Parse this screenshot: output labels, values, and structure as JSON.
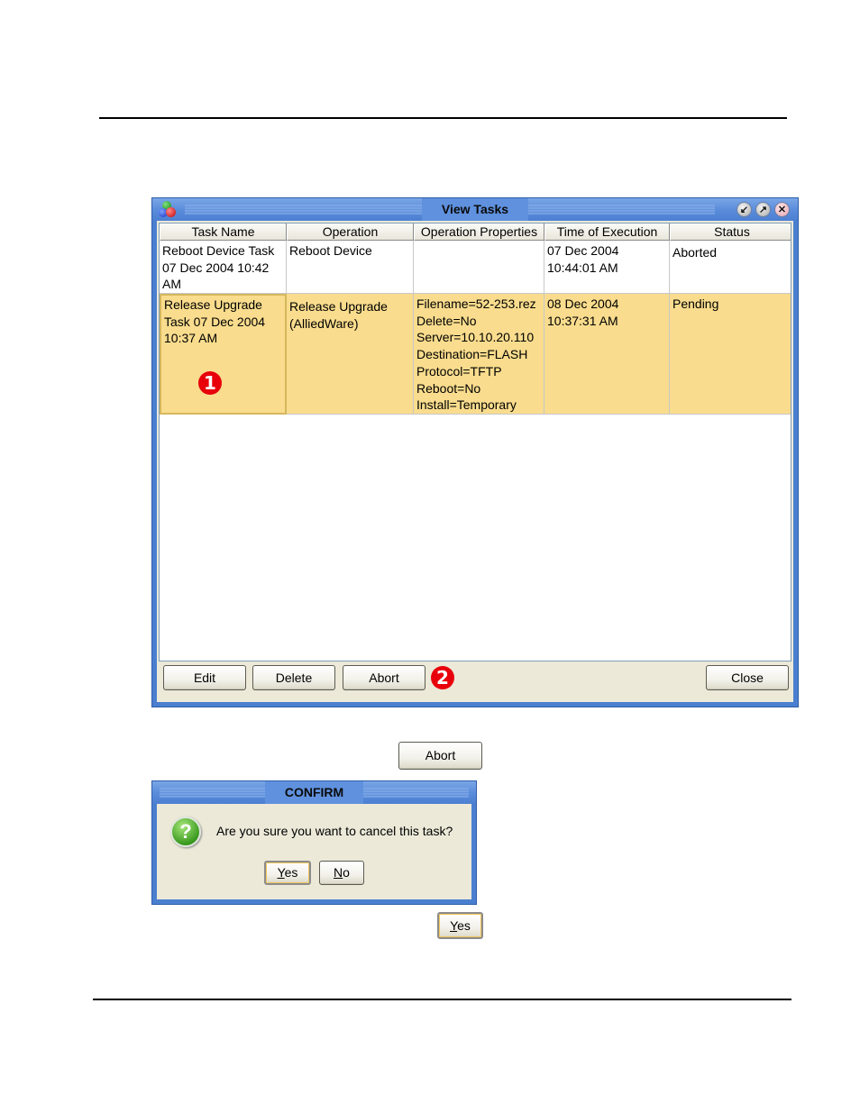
{
  "window": {
    "title": "View Tasks",
    "controls": {
      "minimize": "↙",
      "maximize": "↗",
      "close": "✕"
    },
    "table": {
      "columns": [
        "Task Name",
        "Operation",
        "Operation Properties",
        "Time of Execution",
        "Status"
      ],
      "rows": [
        {
          "task_name": "Reboot Device Task\n07 Dec 2004 10:42\nAM",
          "operation": "Reboot Device",
          "properties": "",
          "time": "07 Dec 2004\n10:44:01 AM",
          "status": "Aborted",
          "selected": false
        },
        {
          "task_name": "Release Upgrade\nTask 07  Dec 2004\n10:37 AM",
          "operation": "Release Upgrade\n(AlliedWare)",
          "properties": "Filename=52-253.rez\nDelete=No\nServer=10.10.20.110\nDestination=FLASH\nProtocol=TFTP\nReboot=No\nInstall=Temporary",
          "time": "08 Dec 2004\n10:37:31 AM",
          "status": "Pending",
          "selected": true
        }
      ]
    },
    "buttons": {
      "edit": "Edit",
      "delete": "Delete",
      "abort": "Abort",
      "close": "Close"
    },
    "selection_color": "#f9dc8d"
  },
  "callouts": {
    "one": "1",
    "two": "2"
  },
  "abort_button_label": "Abort",
  "confirm": {
    "title": "CONFIRM",
    "icon": "question-icon",
    "message": "Are you sure you want to cancel this task?",
    "yes_mnemonic": "Y",
    "yes_rest": "es",
    "no_mnemonic": "N",
    "no_rest": "o"
  },
  "yes_button": {
    "mnemonic": "Y",
    "rest": "es"
  }
}
